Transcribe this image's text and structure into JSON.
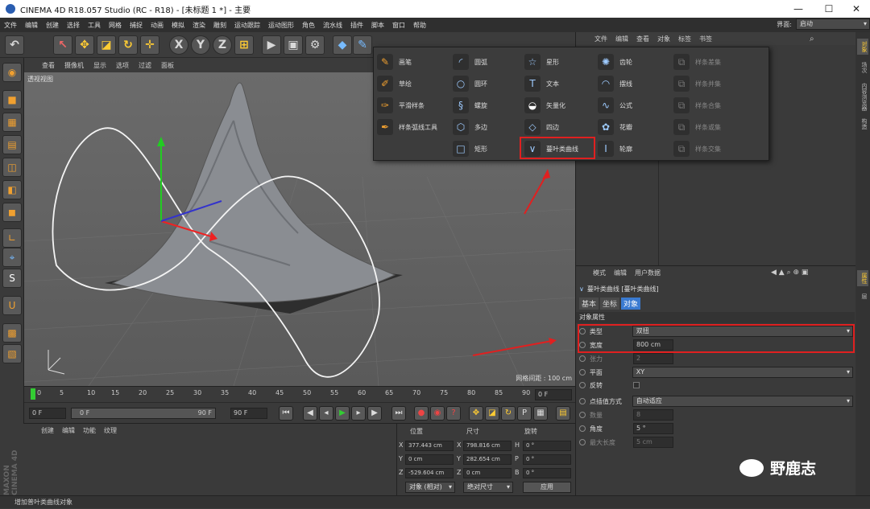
{
  "window": {
    "title": "CINEMA 4D R18.057 Studio (RC - R18) - [未标题 1 *] - 主要",
    "minimize": "—",
    "maximize": "☐",
    "close": "✕"
  },
  "menubar": {
    "items": [
      "文件",
      "编辑",
      "创建",
      "选择",
      "工具",
      "网格",
      "捕捉",
      "动画",
      "模拟",
      "渲染",
      "雕刻",
      "运动跟踪",
      "运动图形",
      "角色",
      "流水线",
      "插件",
      "脚本",
      "窗口",
      "帮助"
    ],
    "layout_label": "界面:",
    "layout_value": "启动"
  },
  "toolbar": {
    "x_label": "X",
    "y_label": "Y",
    "z_label": "Z"
  },
  "viewport_menu": [
    "查看",
    "摄像机",
    "显示",
    "选项",
    "过滤",
    "面板"
  ],
  "viewport": {
    "label": "透视视图",
    "grid_info": "网格间距 : 100 cm"
  },
  "timeline": {
    "ticks": [
      "0",
      "5",
      "10",
      "15",
      "20",
      "25",
      "30",
      "35",
      "40",
      "45",
      "50",
      "55",
      "60",
      "65",
      "70",
      "75",
      "80",
      "85",
      "90"
    ],
    "end_field": "0 F"
  },
  "frames": {
    "start": "0 F",
    "range_start": "0 F",
    "range_end": "90 F",
    "end": "90 F"
  },
  "material_manager": {
    "menu": [
      "创建",
      "编辑",
      "功能",
      "纹理"
    ]
  },
  "coords": {
    "headers": {
      "position": "位置",
      "size": "尺寸",
      "rotation": "旋转"
    },
    "rows": [
      {
        "axis": "X",
        "pos": "377.443 cm",
        "size_axis": "X",
        "size": "798.816 cm",
        "rot_axis": "H",
        "rot": "0 °"
      },
      {
        "axis": "Y",
        "pos": "0 cm",
        "size_axis": "Y",
        "size": "282.654 cm",
        "rot_axis": "P",
        "rot": "0 °"
      },
      {
        "axis": "Z",
        "pos": "-529.604 cm",
        "size_axis": "Z",
        "size": "0 cm",
        "rot_axis": "B",
        "rot": "0 °"
      }
    ],
    "object_mode": "对象 (相对)",
    "size_mode": "绝对尺寸",
    "apply": "应用"
  },
  "status": {
    "text": "增加普叶类曲线对象"
  },
  "object_manager": {
    "menu": [
      "文件",
      "编辑",
      "查看",
      "对象",
      "标签",
      "书签"
    ]
  },
  "side_tabs": {
    "top": [
      "对象",
      "场次",
      "内容浏览器",
      "构造"
    ],
    "bottom": [
      "属性",
      "层"
    ]
  },
  "attributes": {
    "menu": [
      "模式",
      "编辑",
      "用户数据"
    ],
    "object_title": "蔓叶类曲线 [蔓叶类曲线]",
    "tabs": [
      "基本",
      "坐标",
      "对象"
    ],
    "section": "对象属性",
    "type_label": "类型",
    "type_value": "双扭",
    "width_label": "宽度",
    "width_value": "800 cm",
    "tension_label": "张力",
    "tension_value": "2",
    "plane_label": "平面",
    "plane_value": "XY",
    "reverse_label": "反转",
    "interp_label": "点插值方式",
    "interp_value": "自动适应",
    "count_label": "数量",
    "count_value": "8",
    "angle_label": "角度",
    "angle_value": "5 °",
    "maxlen_label": "最大长度",
    "maxlen_value": "5 cm"
  },
  "popup": {
    "col1": [
      "画笔",
      "草绘",
      "平滑样条",
      "样条弧线工具"
    ],
    "col2": [
      "圆弧",
      "圆环",
      "螺旋",
      "多边",
      "矩形"
    ],
    "col3": [
      "星形",
      "文本",
      "矢量化",
      "四边",
      "蔓叶类曲线"
    ],
    "col4": [
      "齿轮",
      "摆线",
      "公式",
      "花瓣",
      "轮廓"
    ],
    "col5": [
      "样条差集",
      "样条并集",
      "样条合集",
      "样条或集",
      "样条交集"
    ]
  },
  "watermark": {
    "text": "野鹿志"
  },
  "brand": {
    "text": "MAXON CINEMA 4D"
  },
  "colors": {
    "highlight": "#e02020",
    "accent_blue": "#2a5db0",
    "timeline_marker": "#33cc33"
  }
}
